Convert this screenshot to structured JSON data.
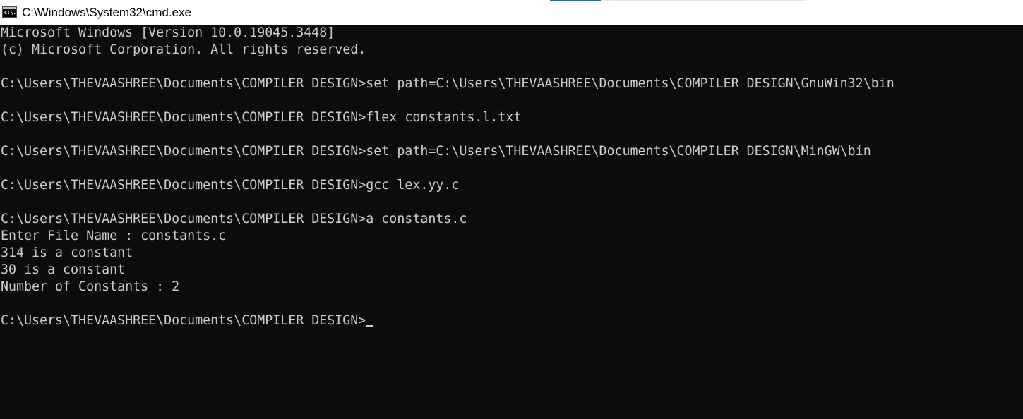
{
  "window": {
    "title": "C:\\Windows\\System32\\cmd.exe",
    "icon": "console-icon",
    "icon_text": "C:\\."
  },
  "console": {
    "lines": [
      "Microsoft Windows [Version 10.0.19045.3448]",
      "(c) Microsoft Corporation. All rights reserved.",
      "",
      "C:\\Users\\THEVAASHREE\\Documents\\COMPILER DESIGN>set path=C:\\Users\\THEVAASHREE\\Documents\\COMPILER DESIGN\\GnuWin32\\bin",
      "",
      "C:\\Users\\THEVAASHREE\\Documents\\COMPILER DESIGN>flex constants.l.txt",
      "",
      "C:\\Users\\THEVAASHREE\\Documents\\COMPILER DESIGN>set path=C:\\Users\\THEVAASHREE\\Documents\\COMPILER DESIGN\\MinGW\\bin",
      "",
      "C:\\Users\\THEVAASHREE\\Documents\\COMPILER DESIGN>gcc lex.yy.c",
      "",
      "C:\\Users\\THEVAASHREE\\Documents\\COMPILER DESIGN>a constants.c",
      "Enter File Name : constants.c",
      "314 is a constant",
      "30 is a constant",
      "Number of Constants : 2",
      ""
    ],
    "prompt": "C:\\Users\\THEVAASHREE\\Documents\\COMPILER DESIGN>"
  },
  "colors": {
    "background": "#0c0c0c",
    "foreground": "#cccccc",
    "titlebar": "#ffffff",
    "accent": "#0078d4"
  }
}
